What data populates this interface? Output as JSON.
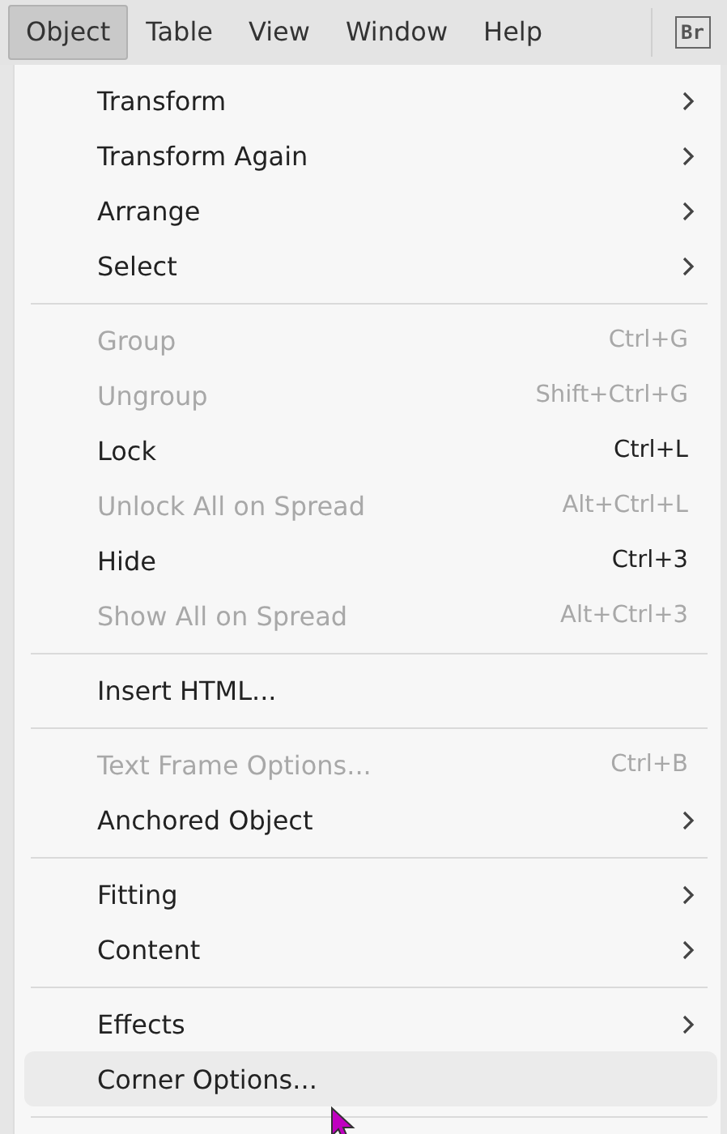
{
  "menubar": {
    "items": [
      {
        "label": "Object",
        "selected": true
      },
      {
        "label": "Table",
        "selected": false
      },
      {
        "label": "View",
        "selected": false
      },
      {
        "label": "Window",
        "selected": false
      },
      {
        "label": "Help",
        "selected": false
      }
    ],
    "badge": "Br"
  },
  "menu": {
    "groups": [
      {
        "items": [
          {
            "label": "Transform",
            "submenu": true,
            "disabled": false,
            "selected": false
          },
          {
            "label": "Transform Again",
            "submenu": true,
            "disabled": false,
            "selected": false
          },
          {
            "label": "Arrange",
            "submenu": true,
            "disabled": false,
            "selected": false
          },
          {
            "label": "Select",
            "submenu": true,
            "disabled": false,
            "selected": false
          }
        ]
      },
      {
        "items": [
          {
            "label": "Group",
            "shortcut": "Ctrl+G",
            "submenu": false,
            "disabled": true,
            "selected": false
          },
          {
            "label": "Ungroup",
            "shortcut": "Shift+Ctrl+G",
            "submenu": false,
            "disabled": true,
            "selected": false
          },
          {
            "label": "Lock",
            "shortcut": "Ctrl+L",
            "submenu": false,
            "disabled": false,
            "selected": false
          },
          {
            "label": "Unlock All on Spread",
            "shortcut": "Alt+Ctrl+L",
            "submenu": false,
            "disabled": true,
            "selected": false
          },
          {
            "label": "Hide",
            "shortcut": "Ctrl+3",
            "submenu": false,
            "disabled": false,
            "selected": false
          },
          {
            "label": "Show All on Spread",
            "shortcut": "Alt+Ctrl+3",
            "submenu": false,
            "disabled": true,
            "selected": false
          }
        ]
      },
      {
        "items": [
          {
            "label": "Insert HTML...",
            "submenu": false,
            "disabled": false,
            "selected": false
          }
        ]
      },
      {
        "items": [
          {
            "label": "Text Frame Options...",
            "shortcut": "Ctrl+B",
            "submenu": false,
            "disabled": true,
            "selected": false
          },
          {
            "label": "Anchored Object",
            "submenu": true,
            "disabled": false,
            "selected": false
          }
        ]
      },
      {
        "items": [
          {
            "label": "Fitting",
            "submenu": true,
            "disabled": false,
            "selected": false
          },
          {
            "label": "Content",
            "submenu": true,
            "disabled": false,
            "selected": false
          }
        ]
      },
      {
        "items": [
          {
            "label": "Effects",
            "submenu": true,
            "disabled": false,
            "selected": false
          },
          {
            "label": "Corner Options...",
            "submenu": false,
            "disabled": false,
            "selected": true
          }
        ]
      }
    ]
  }
}
